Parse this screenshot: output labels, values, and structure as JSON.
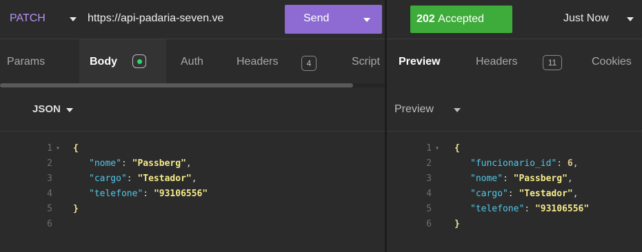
{
  "request": {
    "method": "PATCH",
    "url": "https://api-padaria-seven.ve",
    "send_label": "Send"
  },
  "request_tabs": [
    {
      "label": "Params"
    },
    {
      "label": "Body"
    },
    {
      "label": "Auth"
    },
    {
      "label": "Headers",
      "count": "4"
    },
    {
      "label": "Script"
    }
  ],
  "body_format": "JSON",
  "request_body": [
    {
      "n": "1",
      "text": "{"
    },
    {
      "n": "2",
      "key": "\"nome\"",
      "value": "\"Passberg\""
    },
    {
      "n": "3",
      "key": "\"cargo\"",
      "value": "\"Testador\""
    },
    {
      "n": "4",
      "key": "\"telefone\"",
      "value": "\"93106556\""
    },
    {
      "n": "5",
      "text": "}"
    },
    {
      "n": "6",
      "text": ""
    }
  ],
  "response": {
    "status": "202",
    "status_text": "Accepted",
    "time": "Just Now",
    "status_color": "#3eac3a"
  },
  "response_tabs": [
    {
      "label": "Preview"
    },
    {
      "label": "Headers",
      "count": "11"
    },
    {
      "label": "Cookies"
    }
  ],
  "preview_mode": "Preview",
  "response_body": [
    {
      "n": "1",
      "text": "{"
    },
    {
      "n": "2",
      "key": "\"funcionario_id\"",
      "value": "6"
    },
    {
      "n": "3",
      "key": "\"nome\"",
      "value": "\"Passberg\""
    },
    {
      "n": "4",
      "key": "\"cargo\"",
      "value": "\"Testador\""
    },
    {
      "n": "5",
      "key": "\"telefone\"",
      "value": "\"93106556\""
    },
    {
      "n": "6",
      "text": "}"
    }
  ]
}
